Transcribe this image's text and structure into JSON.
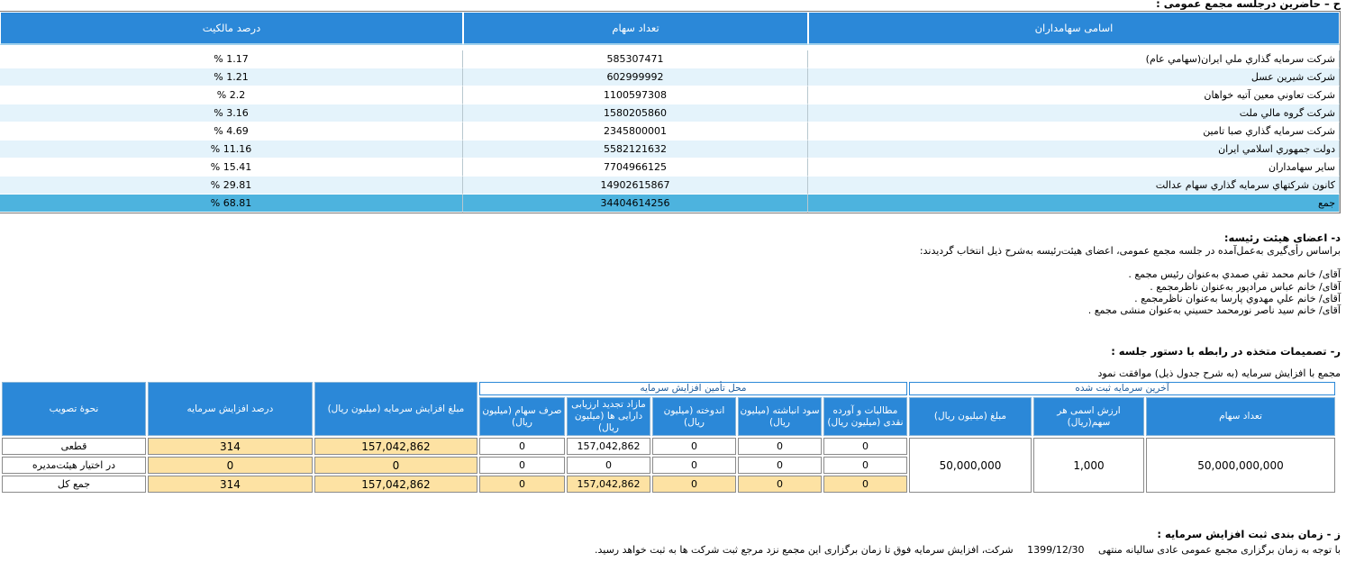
{
  "section_h": {
    "title": "ح – حاضرين درجلسه مجمع عمومی :"
  },
  "shareholders": {
    "headers": {
      "name": "اسامی سهامداران",
      "shares": "تعداد سهام",
      "percent": "درصد مالکیت"
    },
    "rows": [
      {
        "name": "شركت سرمايه گذاري ملي ايران(سهامي عام)",
        "shares": "585307471",
        "percent": "1.17 %"
      },
      {
        "name": "شركت شيرين عسل",
        "shares": "602999992",
        "percent": "1.21 %"
      },
      {
        "name": "شركت تعاوني معين آتيه خواهان",
        "shares": "1100597308",
        "percent": "2.2 %"
      },
      {
        "name": "شركت گروه مالي ملت",
        "shares": "1580205860",
        "percent": "3.16 %"
      },
      {
        "name": "شركت سرمايه گذاري صبا تامين",
        "shares": "2345800001",
        "percent": "4.69 %"
      },
      {
        "name": "دولت جمهوري اسلامي ايران",
        "shares": "5582121632",
        "percent": "11.16 %"
      },
      {
        "name": "ساير سهامداران",
        "shares": "7704966125",
        "percent": "15.41 %"
      },
      {
        "name": "كانون شركتهاي سرمايه گذاري سهام عدالت",
        "shares": "14902615867",
        "percent": "29.81 %"
      }
    ],
    "total": {
      "name": "جمع",
      "shares": "34404614256",
      "percent": "68.81 %"
    }
  },
  "board": {
    "title": "د- اعضای هيئت رئيسه:",
    "intro": "براساس رأی‌گيری به‌عمل‌آمده در جلسه مجمع عمومی، اعضای هيئت‌رئيسه به‌شرح ذيل انتخاب گرديدند:",
    "members": [
      "آقای/ خانم  محمد تقي صمدي  به‌عنوان رئيس مجمع .",
      "آقای/ خانم  عباس مرادپور  به‌عنوان ناظرمجمع .",
      "آقای/ خانم  علي مهدوي پارسا  به‌عنوان ناظرمجمع .",
      "آقای/ خانم  سيد ناصر نورمحمد حسيني  به‌عنوان منشی مجمع ."
    ]
  },
  "decisions": {
    "title": "ر- تصميمات متخذه در رابطه با دستور جلسه :",
    "approval": "مجمع با افزایش سرمایه (به شرح جدول ذیل) موافقت نمود"
  },
  "capital_table": {
    "group_last": "آخرین سرمایه ثبت شده",
    "group_sources": "محل تأمین  افزایش سرمایه",
    "h_shares_count": "تعداد سهام",
    "h_nominal": "ارزش اسمی هر سهم(ریال)",
    "h_amount": "مبلغ (میلیون ریال)",
    "h_receivables": "مطالبات و آورده نقدی (میلیون ریال)",
    "h_accumulated": "سود انباشته (میلیون ریال)",
    "h_reserve": "اندوخته (میلیون ریال)",
    "h_revaluation": "مازاد تجدید ارزیابی دارایی ها (میلیون ریال)",
    "h_premium": "صرف سهام (میلیون ریال)",
    "h_increase_amount": "مبلغ  افزایش سرمایه (میلیون ریال)",
    "h_increase_percent": "درصد افزایش سرمایه",
    "h_approval": "نحوۀ تصویب",
    "last_shares": "50,000,000,000",
    "last_nominal": "1,000",
    "last_amount": "50,000,000",
    "rows": [
      {
        "receivables": "0",
        "accumulated": "0",
        "reserve": "0",
        "revaluation": "157,042,862",
        "premium": "0",
        "amount": "157,042,862",
        "percent": "314",
        "approval": "قطعی"
      },
      {
        "receivables": "0",
        "accumulated": "0",
        "reserve": "0",
        "revaluation": "0",
        "premium": "0",
        "amount": "0",
        "percent": "0",
        "approval": "در اختیار هیئت‌مدیره"
      },
      {
        "receivables": "0",
        "accumulated": "0",
        "reserve": "0",
        "revaluation": "157,042,862",
        "premium": "0",
        "amount": "157,042,862",
        "percent": "314",
        "approval": "جمع کل"
      }
    ]
  },
  "registration": {
    "title": "ز - زمان بندی ثبت افزايش سرمايه :",
    "line_prefix": "با توجه به زمان برگزاری مجمع عمومی عادی ساليانه منتهی",
    "date": "1399/12/30",
    "line_suffix": "شرکت، افزايش سرمايه فوق تا زمان برگزاری اين مجمع نزد مرجع ثبت شرکت ها به ثبت خواهد رسيد."
  }
}
